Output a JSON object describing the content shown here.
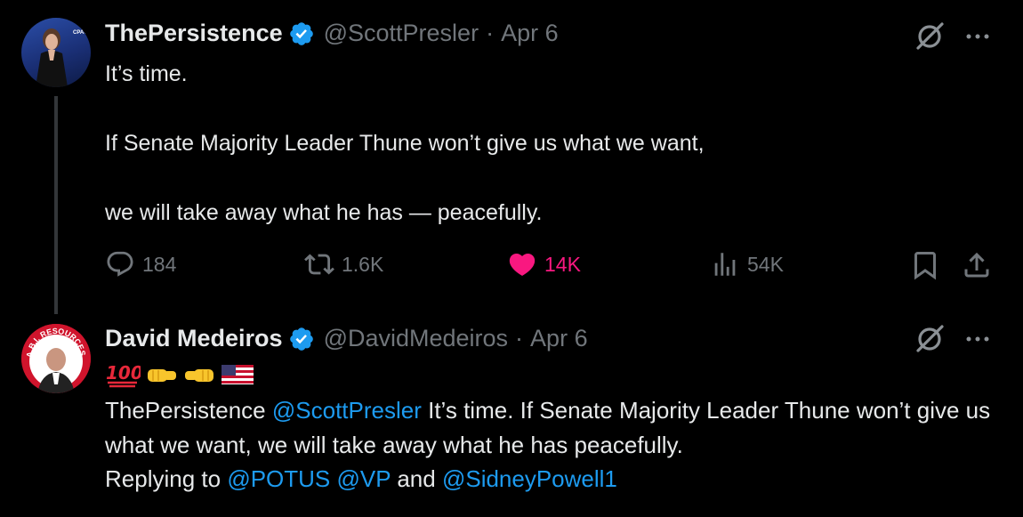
{
  "tweets": [
    {
      "display_name": "ThePersistence",
      "handle": "@ScottPresler",
      "separator": "·",
      "date": "Apr 6",
      "avatar_text": "AMERICAN CONSERVATIVE UNION CPAC",
      "body": [
        "It’s time.",
        "",
        "If Senate Majority Leader Thune won’t give us what we want,",
        "",
        "we will take away what he has — peacefully."
      ],
      "stats": {
        "replies": "184",
        "reposts": "1.6K",
        "likes": "14K",
        "views": "54K"
      }
    },
    {
      "display_name": "David Medeiros",
      "handle": "@DavidMedeiros",
      "separator": "·",
      "date": "Apr 6",
      "avatar_text": "A.B.I. RESOURCES",
      "emojis": [
        "💯",
        "🤜",
        "🤛",
        "🇺🇸"
      ],
      "text": {
        "part1": "ThePersistence ",
        "mention1": "@ScottPresler",
        "part2": " It’s time.   If Senate Majority Leader Thune won’t give us what we want,   we will take away what he has peacefully.",
        "replying_prefix": "Replying to ",
        "mention2": "@POTUS",
        "mention3": "@VP",
        "and_word": " and ",
        "mention4": "@SidneyPowell1"
      }
    }
  ],
  "colors": {
    "background": "#000000",
    "text": "#e7e9ea",
    "muted": "#71767b",
    "link": "#1d9bf0",
    "like": "#f91880",
    "verified": "#1d9bf0"
  },
  "icons": [
    "verified-badge-icon",
    "grok-icon",
    "more-icon",
    "reply-icon",
    "repost-icon",
    "like-icon",
    "views-icon",
    "bookmark-icon",
    "share-icon"
  ]
}
